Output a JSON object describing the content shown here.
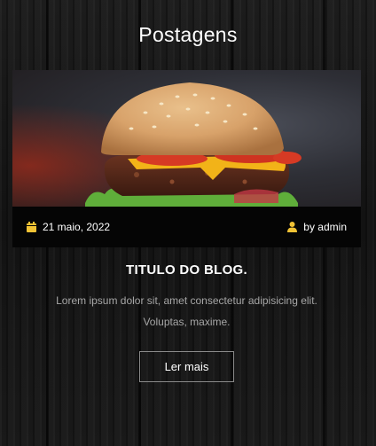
{
  "header": {
    "title": "Postagens"
  },
  "post": {
    "date": "21 maio, 2022",
    "author": "by admin",
    "title": "TITULO DO BLOG.",
    "excerpt": "Lorem ipsum dolor sit, amet consectetur adipisicing elit. Voluptas, maxime.",
    "button_label": "Ler mais",
    "image_alt": "burger"
  },
  "icons": {
    "date": "calendar-icon",
    "author": "user-icon"
  },
  "colors": {
    "icon_accent": "#f2c335",
    "background": "#141414",
    "meta_bar": "#050505",
    "excerpt_text": "#a6a6a6",
    "button_border": "#8a8a8a"
  }
}
